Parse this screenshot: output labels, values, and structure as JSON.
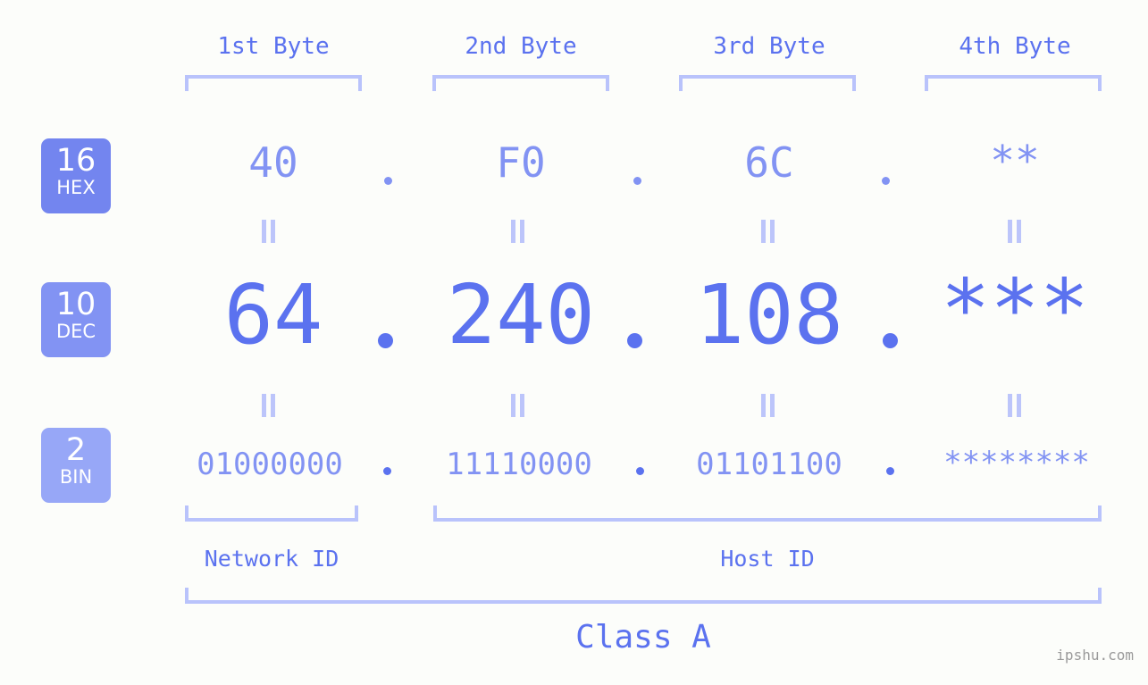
{
  "meta": {
    "background_color": "#fcfdfa",
    "accent_color": "#5b72ef",
    "accent_light_color": "#8293f3",
    "bracket_color": "#b9c3fb",
    "watermark": "ipshu.com"
  },
  "headers": [
    {
      "label": "1st Byte"
    },
    {
      "label": "2nd Byte"
    },
    {
      "label": "3rd Byte"
    },
    {
      "label": "4th Byte"
    }
  ],
  "bases": [
    {
      "num": "16",
      "name": "HEX",
      "color": "#7385ef"
    },
    {
      "num": "10",
      "name": "DEC",
      "color": "#8293f3"
    },
    {
      "num": "2",
      "name": "BIN",
      "color": "#97a7f7"
    }
  ],
  "rows": {
    "hex": {
      "values": [
        "40",
        "F0",
        "6C",
        "**"
      ]
    },
    "dec": {
      "values": [
        "64",
        "240",
        "108",
        "***"
      ]
    },
    "bin": {
      "values": [
        "01000000",
        "11110000",
        "01101100",
        "********"
      ]
    }
  },
  "separators": {
    "dot": ".",
    "equals": "="
  },
  "sections": [
    {
      "label": "Network ID"
    },
    {
      "label": "Host ID"
    }
  ],
  "class": {
    "label": "Class A"
  }
}
